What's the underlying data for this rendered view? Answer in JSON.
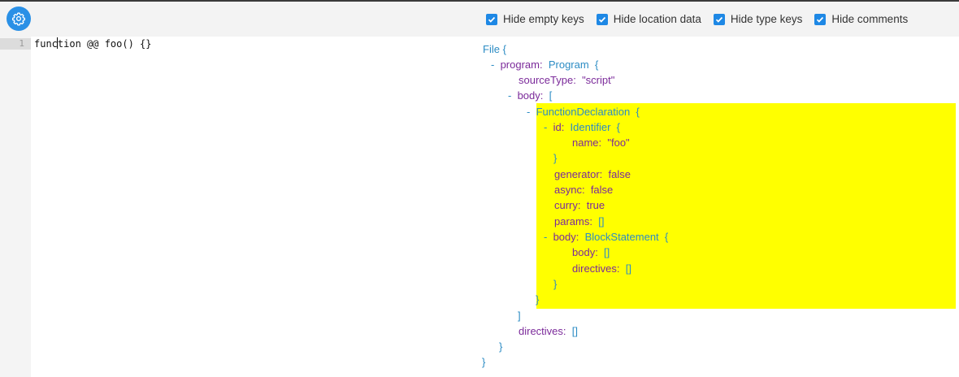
{
  "editor": {
    "settings_icon": "gear-icon",
    "line_number": "1",
    "code_before_cursor": "func",
    "code_after_cursor": "tion @@ foo() {}"
  },
  "options": [
    {
      "label": "Hide empty keys",
      "checked": true
    },
    {
      "label": "Hide location data",
      "checked": true
    },
    {
      "label": "Hide type keys",
      "checked": true
    },
    {
      "label": "Hide comments",
      "checked": true
    }
  ],
  "colors": {
    "accent": "#2a90e6",
    "checkbox": "#1e88e5",
    "highlight": "#ffff00",
    "key": "#7b2a9a",
    "type": "#2c8cc4"
  },
  "ast": {
    "root_type": "File",
    "open_brace": "{",
    "close_brace": "}",
    "toggle": "-",
    "program_key": "program:",
    "program_type": "Program",
    "sourceType_key": "sourceType:",
    "sourceType_value": "\"script\"",
    "body_key": "body:",
    "open_bracket": "[",
    "close_bracket": "]",
    "func_type": "FunctionDeclaration",
    "id_key": "id:",
    "id_type": "Identifier",
    "name_key": "name:",
    "name_value": "\"foo\"",
    "generator_key": "generator:",
    "generator_value": "false",
    "async_key": "async:",
    "async_value": "false",
    "curry_key": "curry:",
    "curry_value": "true",
    "params_key": "params:",
    "params_value": "[]",
    "inner_body_key": "body:",
    "block_type": "BlockStatement",
    "block_body_key": "body:",
    "block_body_value": "[]",
    "block_directives_key": "directives:",
    "block_directives_value": "[]",
    "directives_key": "directives:",
    "directives_value": "[]"
  }
}
